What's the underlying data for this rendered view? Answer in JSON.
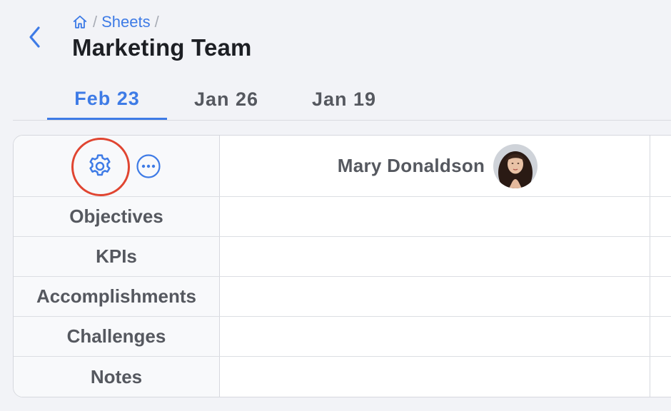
{
  "breadcrumb": {
    "home_icon": "home-icon",
    "separator": "/",
    "items": [
      "Sheets"
    ]
  },
  "page": {
    "title": "Marketing Team"
  },
  "tabs": [
    {
      "label": "Feb 23",
      "active": true
    },
    {
      "label": "Jan 26",
      "active": false
    },
    {
      "label": "Jan 19",
      "active": false
    }
  ],
  "sheet": {
    "person": {
      "name": "Mary Donaldson",
      "avatar": "avatar-photo"
    },
    "header_icons": [
      "gear-icon",
      "more-horizontal-icon"
    ],
    "rows": [
      {
        "label": "Objectives"
      },
      {
        "label": "KPIs"
      },
      {
        "label": "Accomplishments"
      },
      {
        "label": "Challenges"
      },
      {
        "label": "Notes"
      }
    ]
  },
  "colors": {
    "accent": "#3e7be6",
    "highlight_ring": "#e04531",
    "text_primary": "#1d1f24",
    "text_secondary": "#55585f",
    "background": "#f2f3f7"
  }
}
